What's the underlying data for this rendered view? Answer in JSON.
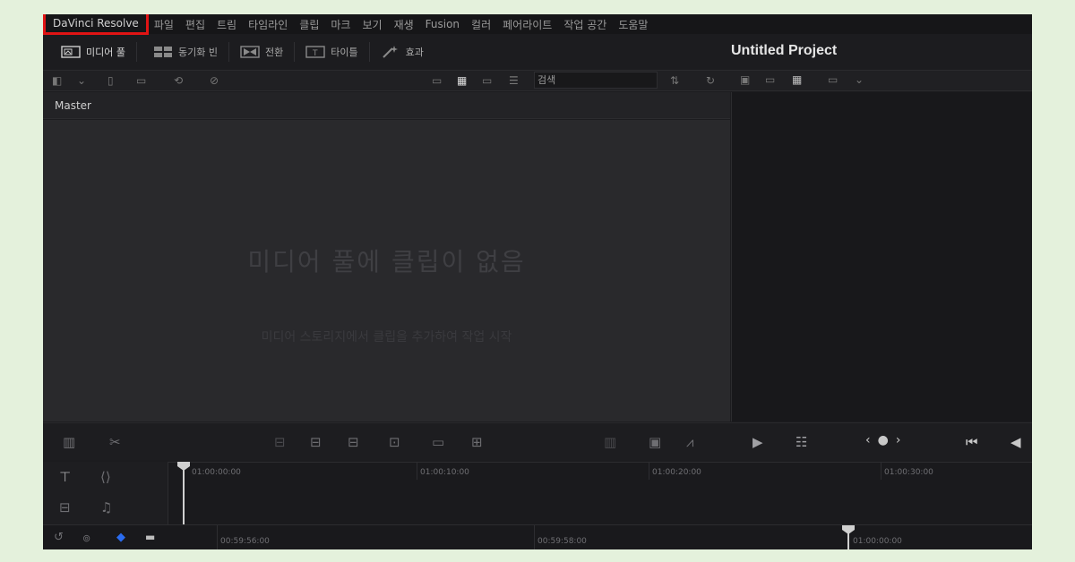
{
  "menubar": {
    "brand": "DaVinci Resolve",
    "items": [
      "파일",
      "편집",
      "트림",
      "타임라인",
      "클립",
      "마크",
      "보기",
      "재생",
      "Fusion",
      "컬러",
      "페어라이트",
      "작업 공간",
      "도움말"
    ]
  },
  "toolbar": {
    "media_pool": "미디어 풀",
    "sync_bin": "동기화 빈",
    "transitions": "전환",
    "titles": "타이틀",
    "effects": "효과"
  },
  "project": {
    "title": "Untitled Project"
  },
  "search": {
    "value": "검색"
  },
  "bin": {
    "name": "Master"
  },
  "media_pool_empty": {
    "title": "미디어 풀에 클립이 없음",
    "subtitle": "미디어 스토리지에서 클립을 추가하여 작업 시작"
  },
  "timeline": {
    "ruler_timecodes": [
      "01:00:00:00",
      "01:00:10:00",
      "01:00:20:00",
      "01:00:30:00"
    ],
    "mini_timecodes": [
      "00:59:56:00",
      "00:59:58:00",
      "01:00:00:00"
    ]
  },
  "colors": {
    "highlight": "#e01414",
    "accent": "#2a6cf0",
    "background": "#1c1c1f"
  }
}
